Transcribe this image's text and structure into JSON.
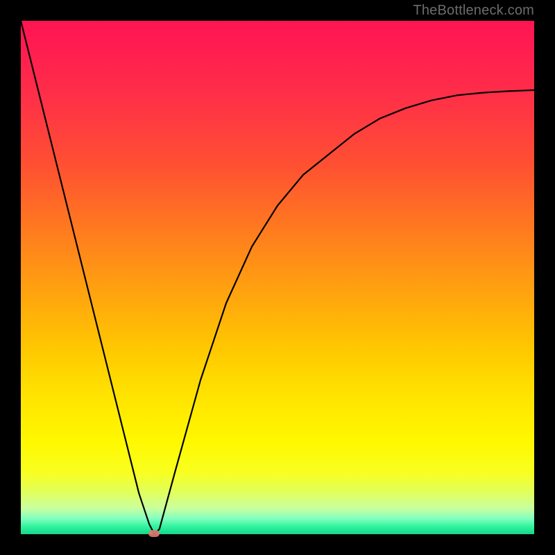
{
  "watermark_text": "TheBottleneck.com",
  "chart_data": {
    "type": "line",
    "title": "",
    "xlabel": "",
    "ylabel": "",
    "x_range": [
      0,
      100
    ],
    "y_range": [
      0,
      100
    ],
    "series": [
      {
        "name": "bottleneck-curve",
        "x": [
          0,
          5,
          10,
          15,
          20,
          23,
          25,
          26,
          27,
          30,
          35,
          40,
          45,
          50,
          55,
          60,
          65,
          70,
          75,
          80,
          85,
          90,
          95,
          100
        ],
        "y": [
          100,
          80,
          60,
          40,
          20,
          8,
          2,
          0,
          1,
          12,
          30,
          45,
          56,
          64,
          70,
          74,
          78,
          81,
          83,
          84.5,
          85.5,
          86,
          86.3,
          86.5
        ]
      }
    ],
    "marker": {
      "x": 26,
      "y": 0
    },
    "background_gradient": {
      "top": "#ff1452",
      "bottom": "#14d788",
      "meaning": "red=high bottleneck, green=low bottleneck"
    }
  }
}
